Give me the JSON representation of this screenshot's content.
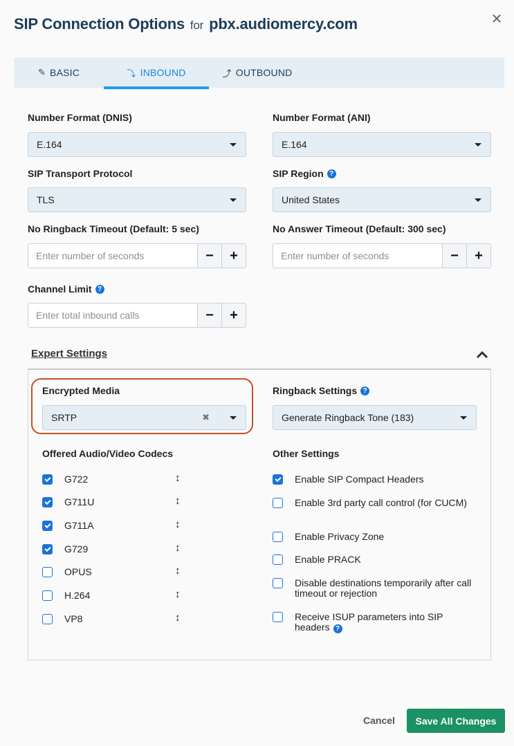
{
  "header": {
    "title": "SIP Connection Options",
    "for_text": "for",
    "host": "pbx.audiomercy.com",
    "close_icon": "close-icon"
  },
  "tabs": [
    {
      "label": "BASIC",
      "icon": "pencil-icon",
      "active": false
    },
    {
      "label": "INBOUND",
      "icon": "inbound-arrow-icon",
      "active": true
    },
    {
      "label": "OUTBOUND",
      "icon": "outbound-arrow-icon",
      "active": false
    }
  ],
  "form": {
    "number_format_dnis": {
      "label": "Number Format (DNIS)",
      "value": "E.164"
    },
    "number_format_ani": {
      "label": "Number Format (ANI)",
      "value": "E.164"
    },
    "sip_transport": {
      "label": "SIP Transport Protocol",
      "value": "TLS"
    },
    "sip_region": {
      "label": "SIP Region",
      "value": "United States"
    },
    "no_ringback_timeout": {
      "label": "No Ringback Timeout (Default: 5 sec)",
      "placeholder": "Enter number of seconds",
      "value": ""
    },
    "no_answer_timeout": {
      "label": "No Answer Timeout (Default: 300 sec)",
      "placeholder": "Enter number of seconds",
      "value": ""
    },
    "channel_limit": {
      "label": "Channel Limit",
      "placeholder": "Enter total inbound calls",
      "value": ""
    },
    "minus_label": "−",
    "plus_label": "+"
  },
  "expert": {
    "title": "Expert Settings",
    "expanded": true,
    "encrypted_media": {
      "label": "Encrypted Media",
      "value": "SRTP"
    },
    "ringback_settings": {
      "label": "Ringback Settings",
      "value": "Generate Ringback Tone (183)"
    },
    "codecs_title": "Offered Audio/Video Codecs",
    "codecs": [
      {
        "label": "G722",
        "checked": true
      },
      {
        "label": "G711U",
        "checked": true
      },
      {
        "label": "G711A",
        "checked": true
      },
      {
        "label": "G729",
        "checked": true
      },
      {
        "label": "OPUS",
        "checked": false
      },
      {
        "label": "H.264",
        "checked": false
      },
      {
        "label": "VP8",
        "checked": false
      }
    ],
    "other_title": "Other Settings",
    "other": [
      {
        "label": "Enable SIP Compact Headers",
        "checked": true
      },
      {
        "label": "Enable 3rd party call control (for CUCM)",
        "checked": false
      },
      {
        "label": "Enable Privacy Zone",
        "checked": false
      },
      {
        "label": "Enable PRACK",
        "checked": false
      },
      {
        "label": "Disable destinations temporarily after call timeout or rejection",
        "checked": false
      },
      {
        "label": "Receive ISUP parameters into SIP headers",
        "checked": false,
        "help": true
      }
    ]
  },
  "footer": {
    "cancel_label": "Cancel",
    "save_label": "Save All Changes"
  },
  "colors": {
    "title": "#1c3d5a",
    "tab_active": "#1a86d9",
    "tab_underline": "#1ba0f2",
    "checkbox": "#1a73d9",
    "highlight_outline": "#c8501e",
    "save_button": "#1b9165"
  }
}
